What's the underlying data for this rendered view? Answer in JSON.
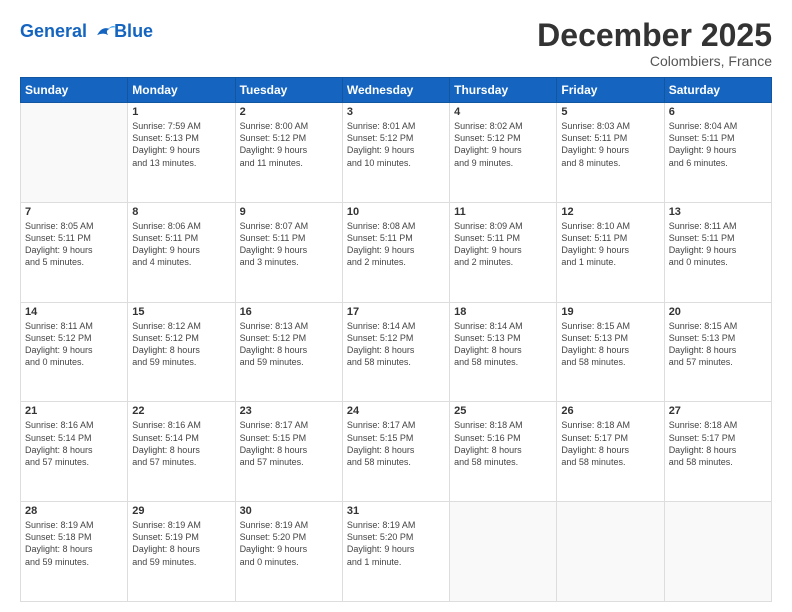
{
  "logo": {
    "line1": "General",
    "line2": "Blue"
  },
  "title": "December 2025",
  "subtitle": "Colombiers, France",
  "weekdays": [
    "Sunday",
    "Monday",
    "Tuesday",
    "Wednesday",
    "Thursday",
    "Friday",
    "Saturday"
  ],
  "weeks": [
    [
      {
        "day": "",
        "info": ""
      },
      {
        "day": "1",
        "info": "Sunrise: 7:59 AM\nSunset: 5:13 PM\nDaylight: 9 hours\nand 13 minutes."
      },
      {
        "day": "2",
        "info": "Sunrise: 8:00 AM\nSunset: 5:12 PM\nDaylight: 9 hours\nand 11 minutes."
      },
      {
        "day": "3",
        "info": "Sunrise: 8:01 AM\nSunset: 5:12 PM\nDaylight: 9 hours\nand 10 minutes."
      },
      {
        "day": "4",
        "info": "Sunrise: 8:02 AM\nSunset: 5:12 PM\nDaylight: 9 hours\nand 9 minutes."
      },
      {
        "day": "5",
        "info": "Sunrise: 8:03 AM\nSunset: 5:11 PM\nDaylight: 9 hours\nand 8 minutes."
      },
      {
        "day": "6",
        "info": "Sunrise: 8:04 AM\nSunset: 5:11 PM\nDaylight: 9 hours\nand 6 minutes."
      }
    ],
    [
      {
        "day": "7",
        "info": "Sunrise: 8:05 AM\nSunset: 5:11 PM\nDaylight: 9 hours\nand 5 minutes."
      },
      {
        "day": "8",
        "info": "Sunrise: 8:06 AM\nSunset: 5:11 PM\nDaylight: 9 hours\nand 4 minutes."
      },
      {
        "day": "9",
        "info": "Sunrise: 8:07 AM\nSunset: 5:11 PM\nDaylight: 9 hours\nand 3 minutes."
      },
      {
        "day": "10",
        "info": "Sunrise: 8:08 AM\nSunset: 5:11 PM\nDaylight: 9 hours\nand 2 minutes."
      },
      {
        "day": "11",
        "info": "Sunrise: 8:09 AM\nSunset: 5:11 PM\nDaylight: 9 hours\nand 2 minutes."
      },
      {
        "day": "12",
        "info": "Sunrise: 8:10 AM\nSunset: 5:11 PM\nDaylight: 9 hours\nand 1 minute."
      },
      {
        "day": "13",
        "info": "Sunrise: 8:11 AM\nSunset: 5:11 PM\nDaylight: 9 hours\nand 0 minutes."
      }
    ],
    [
      {
        "day": "14",
        "info": "Sunrise: 8:11 AM\nSunset: 5:12 PM\nDaylight: 9 hours\nand 0 minutes."
      },
      {
        "day": "15",
        "info": "Sunrise: 8:12 AM\nSunset: 5:12 PM\nDaylight: 8 hours\nand 59 minutes."
      },
      {
        "day": "16",
        "info": "Sunrise: 8:13 AM\nSunset: 5:12 PM\nDaylight: 8 hours\nand 59 minutes."
      },
      {
        "day": "17",
        "info": "Sunrise: 8:14 AM\nSunset: 5:12 PM\nDaylight: 8 hours\nand 58 minutes."
      },
      {
        "day": "18",
        "info": "Sunrise: 8:14 AM\nSunset: 5:13 PM\nDaylight: 8 hours\nand 58 minutes."
      },
      {
        "day": "19",
        "info": "Sunrise: 8:15 AM\nSunset: 5:13 PM\nDaylight: 8 hours\nand 58 minutes."
      },
      {
        "day": "20",
        "info": "Sunrise: 8:15 AM\nSunset: 5:13 PM\nDaylight: 8 hours\nand 57 minutes."
      }
    ],
    [
      {
        "day": "21",
        "info": "Sunrise: 8:16 AM\nSunset: 5:14 PM\nDaylight: 8 hours\nand 57 minutes."
      },
      {
        "day": "22",
        "info": "Sunrise: 8:16 AM\nSunset: 5:14 PM\nDaylight: 8 hours\nand 57 minutes."
      },
      {
        "day": "23",
        "info": "Sunrise: 8:17 AM\nSunset: 5:15 PM\nDaylight: 8 hours\nand 57 minutes."
      },
      {
        "day": "24",
        "info": "Sunrise: 8:17 AM\nSunset: 5:15 PM\nDaylight: 8 hours\nand 58 minutes."
      },
      {
        "day": "25",
        "info": "Sunrise: 8:18 AM\nSunset: 5:16 PM\nDaylight: 8 hours\nand 58 minutes."
      },
      {
        "day": "26",
        "info": "Sunrise: 8:18 AM\nSunset: 5:17 PM\nDaylight: 8 hours\nand 58 minutes."
      },
      {
        "day": "27",
        "info": "Sunrise: 8:18 AM\nSunset: 5:17 PM\nDaylight: 8 hours\nand 58 minutes."
      }
    ],
    [
      {
        "day": "28",
        "info": "Sunrise: 8:19 AM\nSunset: 5:18 PM\nDaylight: 8 hours\nand 59 minutes."
      },
      {
        "day": "29",
        "info": "Sunrise: 8:19 AM\nSunset: 5:19 PM\nDaylight: 8 hours\nand 59 minutes."
      },
      {
        "day": "30",
        "info": "Sunrise: 8:19 AM\nSunset: 5:20 PM\nDaylight: 9 hours\nand 0 minutes."
      },
      {
        "day": "31",
        "info": "Sunrise: 8:19 AM\nSunset: 5:20 PM\nDaylight: 9 hours\nand 1 minute."
      },
      {
        "day": "",
        "info": ""
      },
      {
        "day": "",
        "info": ""
      },
      {
        "day": "",
        "info": ""
      }
    ]
  ]
}
